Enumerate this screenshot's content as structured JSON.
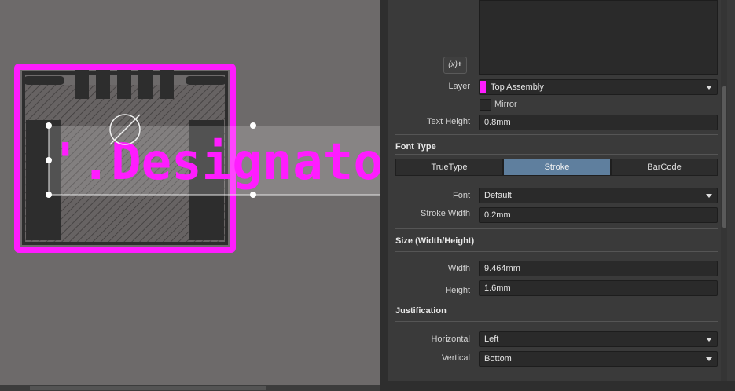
{
  "canvas": {
    "designator_text": "'.Designato",
    "colors": {
      "layer": "#ff1cff",
      "body": "#2d2d2d",
      "hatch": "#5a5656"
    }
  },
  "panel": {
    "fx_button": "(x)",
    "layer_label": "Layer",
    "layer_value": "Top Assembly",
    "layer_color": "#ff1cff",
    "mirror_label": "Mirror",
    "text_height_label": "Text Height",
    "text_height_value": "0.8mm",
    "font_type_title": "Font Type",
    "font_types": [
      "TrueType",
      "Stroke",
      "BarCode"
    ],
    "font_type_selected": "Stroke",
    "font_label": "Font",
    "font_value": "Default",
    "stroke_width_label": "Stroke Width",
    "stroke_width_value": "0.2mm",
    "size_title": "Size (Width/Height)",
    "width_label": "Width",
    "width_value": "9.464mm",
    "height_label": "Height",
    "height_value": "1.6mm",
    "justification_title": "Justification",
    "horizontal_label": "Horizontal",
    "horizontal_value": "Left",
    "vertical_label": "Vertical",
    "vertical_value": "Bottom"
  }
}
